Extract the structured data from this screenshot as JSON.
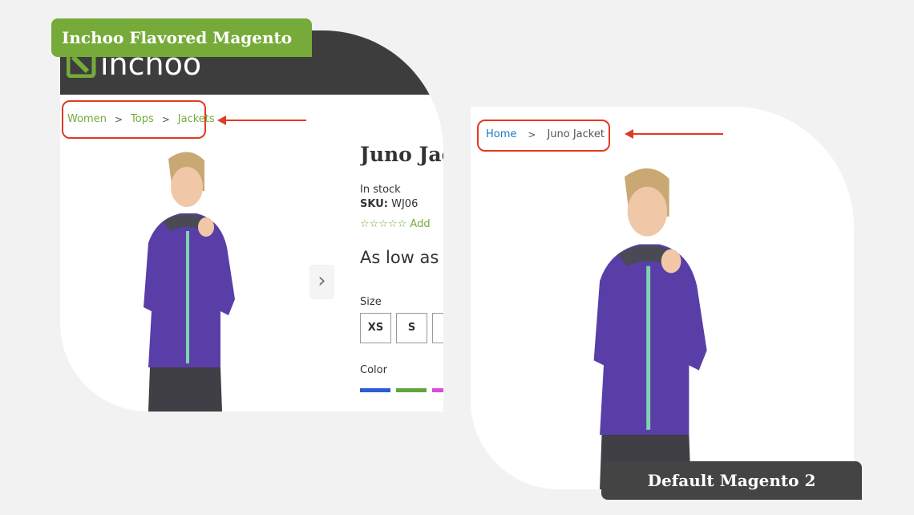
{
  "inchoo": {
    "label": "Inchoo Flavored Magento",
    "logo_text": "inchoo",
    "breadcrumbs": [
      "Women",
      "Tops",
      "Jackets"
    ],
    "product": {
      "title": "Juno Jac",
      "stock": "In stock",
      "sku_label": "SKU:",
      "sku": "WJ06",
      "stars": "☆☆☆☆☆",
      "review_link": "Add",
      "price": "As low as $",
      "size_label": "Size",
      "sizes": [
        "XS",
        "S",
        ""
      ],
      "color_label": "Color",
      "colors": [
        "#2c5bd6",
        "#5ea540",
        "#d94ad9"
      ]
    },
    "next_icon": "chevron-right-icon"
  },
  "default": {
    "label": "Default Magento 2",
    "breadcrumbs": [
      "Home",
      "Juno Jacket"
    ]
  },
  "colors": {
    "inchoo_green": "#76ab3a",
    "header_dark": "#3d3d3d",
    "highlight_red": "#e23a22",
    "magento_link_blue": "#1979c3"
  }
}
